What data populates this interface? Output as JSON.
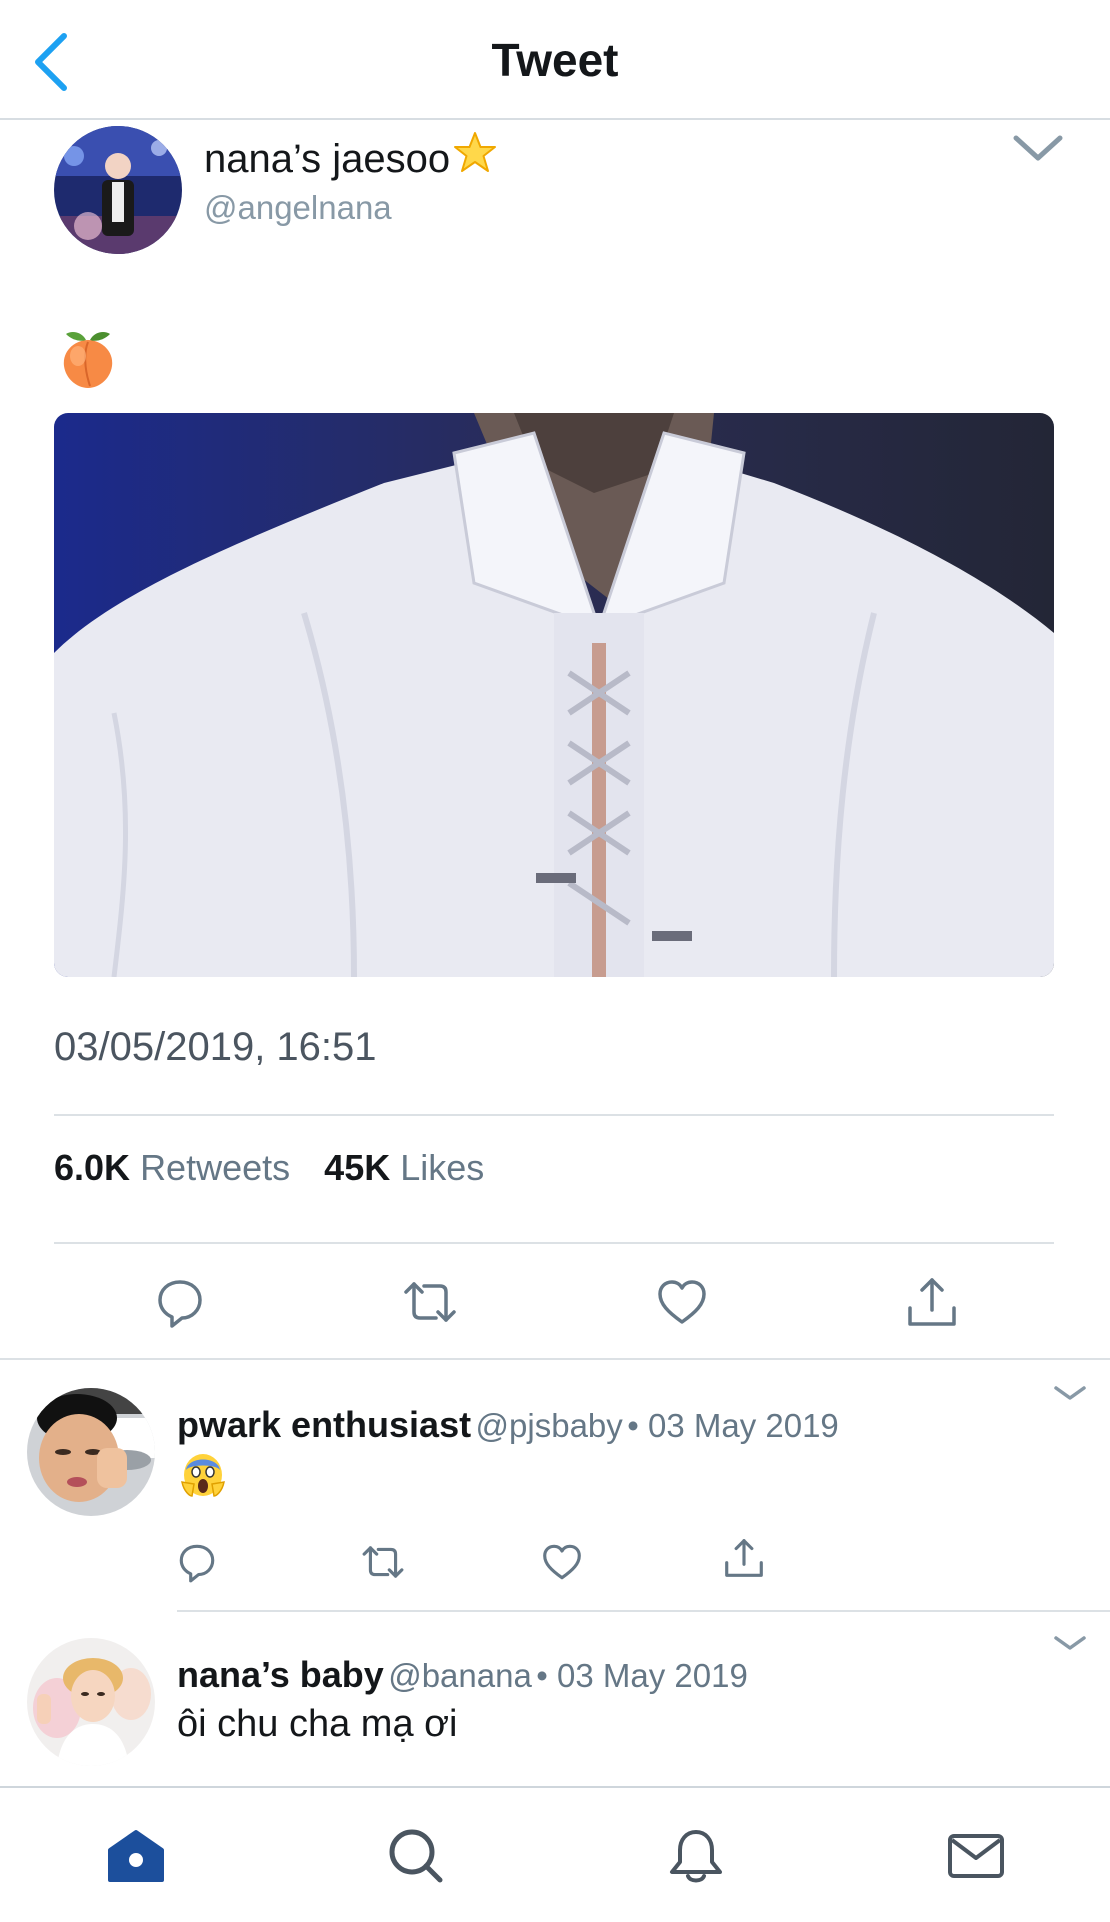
{
  "header": {
    "title": "Tweet"
  },
  "tweet": {
    "display_name": "nana’s jaesoo",
    "handle": "@angelnana",
    "text_emoji": "peach",
    "timestamp": "03/05/2019, 16:51",
    "retweet_count": "6.0K",
    "retweet_label": "Retweets",
    "like_count": "45K",
    "like_label": "Likes"
  },
  "replies": [
    {
      "display_name": "pwark enthusiast",
      "handle": "@pjsbaby",
      "date": "• 03 May 2019",
      "text": "",
      "emoji": "face-screaming-in-fear"
    },
    {
      "display_name": "nana’s baby",
      "handle": "@banana",
      "date": "• 03 May 2019",
      "text": "ôi chu cha mạ ơi"
    }
  ],
  "colors": {
    "accent": "#1da1f2",
    "icon_gray": "#657786",
    "tab_active": "#1c4f9c",
    "tab_icon": "#4a5560"
  }
}
